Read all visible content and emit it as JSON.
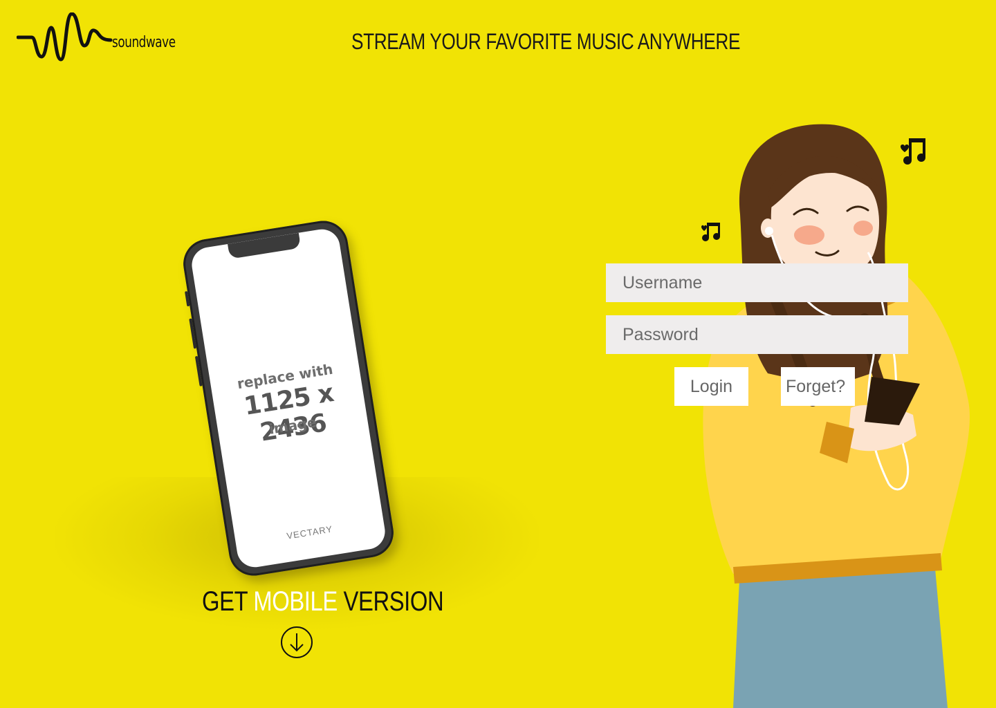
{
  "brand": {
    "name": "soundwave",
    "logo_icon": "soundwave-logo-icon"
  },
  "header": {
    "headline": "STREAM YOUR FAVORITE MUSIC ANYWHERE"
  },
  "phone_mockup": {
    "line1": "replace with",
    "line2": "1125 x 2436",
    "line3": "image",
    "brand": "VECTARY"
  },
  "mobile_cta": {
    "part1": "GET ",
    "highlight": "MOBILE",
    "part2": " VERSION",
    "icon": "download-arrow-icon"
  },
  "login_form": {
    "username_placeholder": "Username",
    "password_placeholder": "Password",
    "login_label": "Login",
    "forget_label": "Forget?"
  },
  "colors": {
    "background": "#f1e305",
    "field": "#efeded",
    "highlight": "#ffffff"
  }
}
